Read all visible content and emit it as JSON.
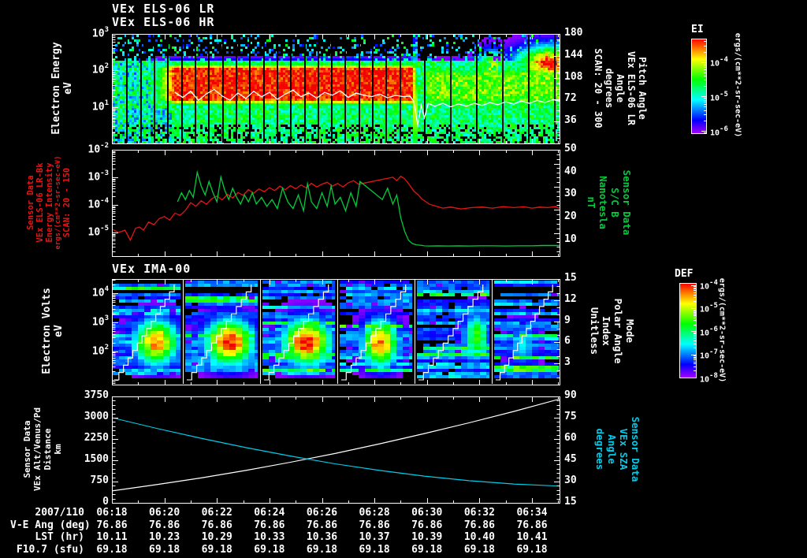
{
  "plot": {
    "date_label": "2007/110",
    "colors": {
      "background": "#000000",
      "frame": "#ffffff",
      "red": "#e81414",
      "green": "#00cd3c",
      "cyan": "#00cdeb",
      "white": "#ffffff"
    }
  },
  "time_axis": {
    "labels": [
      "06:18",
      "06:20",
      "06:22",
      "06:24",
      "06:26",
      "06:28",
      "06:30",
      "06:32",
      "06:34"
    ],
    "start_min": 0,
    "end_min": 17.05,
    "tick_interval_min": 2
  },
  "bottom_table": {
    "rows": [
      {
        "label": "2007/110",
        "values": [
          "06:18",
          "06:20",
          "06:22",
          "06:24",
          "06:26",
          "06:28",
          "06:30",
          "06:32",
          "06:34"
        ]
      },
      {
        "label": "V-E Ang (deg)",
        "values": [
          "76.86",
          "76.86",
          "76.86",
          "76.86",
          "76.86",
          "76.86",
          "76.86",
          "76.86",
          "76.86"
        ]
      },
      {
        "label": "LST (hr)",
        "values": [
          "10.11",
          "10.23",
          "10.29",
          "10.33",
          "10.36",
          "10.37",
          "10.39",
          "10.40",
          "10.41"
        ]
      },
      {
        "label": "F10.7 (sfu)",
        "values": [
          "69.18",
          "69.18",
          "69.18",
          "69.18",
          "69.18",
          "69.18",
          "69.18",
          "69.18",
          "69.18"
        ]
      }
    ]
  },
  "chart_data": [
    {
      "id": "els-spectrogram",
      "type": "heatmap",
      "titles": [
        "VEx ELS-06 LR",
        "VEx ELS-06 HR"
      ],
      "y_axis": {
        "label_lines": [
          "Electron Energy",
          "eV"
        ],
        "scale": "log",
        "ticks": [
          "10^3",
          "10^2",
          "10^1"
        ],
        "range_log10": [
          0,
          3
        ]
      },
      "right_axis": {
        "label_lines": [
          "Pitch Angle",
          "VEx ELS-06 LR",
          "Angle",
          "degrees",
          "SCAN: 20 - 300"
        ],
        "ticks": [
          180,
          144,
          108,
          72,
          36
        ],
        "range": [
          0,
          180
        ]
      },
      "colorbar": {
        "title": "EI",
        "ticks": [
          "10^-4",
          "10^-5",
          "10^-6"
        ],
        "range_log10": [
          -3.32,
          -6.07
        ],
        "unit": "ergs/(cm**2-sr-sec-eV)"
      },
      "description": "Electron energy-time spectrogram: intense 15-100 eV magnetosheath electron flux from ~06:20 to ~06:29.5, abrupt cutoff near 06:29.5, weaker yellow-green ionospheric flux after; scattered counts above 200 eV; regular vertical telemetry-gap stripes.",
      "overlay_line": {
        "name": "spacecraft-potential-trace",
        "color": "#ffffff",
        "t_min": [
          2.4,
          2.7,
          3.0,
          3.3,
          3.6,
          3.9,
          4.2,
          4.5,
          4.8,
          5.1,
          5.4,
          5.7,
          6.0,
          6.3,
          6.6,
          6.9,
          7.2,
          7.5,
          7.8,
          8.1,
          8.4,
          8.7,
          9.0,
          9.3,
          9.6,
          9.9,
          10.2,
          10.5,
          10.8,
          11.1,
          11.35,
          11.5,
          11.65,
          11.78,
          11.9,
          12.05,
          12.3,
          12.6,
          12.9,
          13.2,
          13.5,
          13.8,
          14.1,
          14.4,
          14.7,
          15.0,
          15.3,
          15.6,
          15.9,
          16.2,
          16.5,
          16.8,
          17.05
        ],
        "log10_eV": [
          1.4,
          1.26,
          1.43,
          1.18,
          1.36,
          1.48,
          1.3,
          1.18,
          1.38,
          1.23,
          1.43,
          1.28,
          1.4,
          1.21,
          1.35,
          1.46,
          1.28,
          1.38,
          1.24,
          1.4,
          1.32,
          1.44,
          1.26,
          1.38,
          1.32,
          1.28,
          1.35,
          1.25,
          1.32,
          1.28,
          1.3,
          1.15,
          0.5,
          1.05,
          0.7,
          1.1,
          1.02,
          1.1,
          1.0,
          1.08,
          1.02,
          1.1,
          1.04,
          1.12,
          1.06,
          1.14,
          1.08,
          1.16,
          1.1,
          1.18,
          1.12,
          1.2,
          1.16
        ]
      },
      "render": {
        "seed": 42,
        "band_center_log10": 1.62,
        "band_halfwidth": 0.38,
        "band_fringe_sigma": 0.15,
        "band_t_start": 1.1,
        "band_t_full": 2.4,
        "band_t_end": 11.45,
        "post_center_log10": 1.55,
        "post_halfwidth": 0.3,
        "post_amp": 0.64,
        "gap_t0": 0.55,
        "gap_t1": 11.4,
        "gap_step_min": 0.52,
        "gap2_t0": 11.9,
        "gap2_step_min": 0.99
      }
    },
    {
      "id": "els-intensity-and-bfield",
      "type": "line",
      "left_axis": {
        "color_key": "red",
        "label_lines": [
          "Sensor Data",
          "VEx ELS-06 LR-Bk",
          "Energy Intensity",
          "ergs/(cm**2-sr-sec-eV)",
          "SCAN: 20 - 150"
        ],
        "scale": "log",
        "ticks": [
          "10^-2",
          "10^-3",
          "10^-4",
          "10^-5"
        ],
        "range_log10": [
          -5.86,
          -2
        ]
      },
      "right_axis": {
        "color_key": "green",
        "label_lines": [
          "Sensor Data",
          "S/C B",
          "Nanotesla",
          "nT"
        ],
        "ticks": [
          50,
          40,
          30,
          20,
          10
        ],
        "range": [
          3,
          50
        ]
      },
      "series": [
        {
          "name": "ELS-06 LR-Bk energy intensity",
          "axis": "left",
          "color": "#e81414",
          "t_min": [
            0.0,
            0.25,
            0.5,
            0.7,
            0.9,
            1.05,
            1.2,
            1.4,
            1.6,
            1.8,
            2.0,
            2.2,
            2.4,
            2.6,
            2.8,
            3.0,
            3.2,
            3.4,
            3.6,
            3.8,
            4.0,
            4.2,
            4.4,
            4.6,
            4.8,
            5.0,
            5.2,
            5.4,
            5.6,
            5.8,
            6.0,
            6.2,
            6.4,
            6.6,
            6.8,
            7.0,
            7.2,
            7.4,
            7.6,
            7.8,
            8.0,
            8.2,
            8.4,
            8.6,
            8.8,
            9.0,
            9.2,
            9.4,
            10.7,
            10.85,
            11.0,
            11.15,
            11.35,
            11.5,
            11.65,
            11.8,
            11.95,
            12.1,
            12.35,
            12.6,
            12.9,
            13.3,
            13.7,
            14.1,
            14.5,
            14.9,
            15.3,
            15.7,
            16.0,
            16.3,
            16.6,
            16.9,
            17.0,
            17.05
          ],
          "log10_v": [
            -4.88,
            -5.0,
            -4.92,
            -5.28,
            -4.85,
            -4.8,
            -4.92,
            -4.62,
            -4.72,
            -4.5,
            -4.42,
            -4.55,
            -4.3,
            -4.38,
            -4.2,
            -3.92,
            -4.05,
            -3.85,
            -3.98,
            -3.78,
            -3.68,
            -3.82,
            -3.62,
            -3.75,
            -3.55,
            -3.65,
            -3.45,
            -3.58,
            -3.42,
            -3.52,
            -3.38,
            -3.48,
            -3.32,
            -3.45,
            -3.3,
            -3.42,
            -3.28,
            -3.38,
            -3.22,
            -3.35,
            -3.25,
            -3.18,
            -3.32,
            -3.22,
            -3.35,
            -3.2,
            -3.12,
            -3.25,
            -3.0,
            -3.12,
            -2.96,
            -3.05,
            -3.3,
            -3.5,
            -3.62,
            -3.78,
            -3.88,
            -3.98,
            -4.05,
            -4.12,
            -4.08,
            -4.15,
            -4.1,
            -4.08,
            -4.12,
            -4.06,
            -4.1,
            -4.07,
            -4.12,
            -4.08,
            -4.1,
            -4.06,
            -4.12,
            -4.09
          ]
        },
        {
          "name": "spacecraft magnetic field B",
          "axis": "right",
          "color": "#00cd3c",
          "t_min": [
            2.5,
            2.65,
            2.8,
            2.95,
            3.1,
            3.25,
            3.4,
            3.55,
            3.7,
            3.85,
            4.0,
            4.15,
            4.3,
            4.45,
            4.6,
            4.75,
            4.9,
            5.05,
            5.2,
            5.35,
            5.5,
            5.7,
            5.9,
            6.1,
            6.3,
            6.5,
            6.7,
            6.9,
            7.1,
            7.3,
            7.45,
            7.6,
            7.8,
            8.0,
            8.2,
            8.35,
            8.5,
            8.7,
            8.9,
            9.1,
            9.3,
            9.45,
            10.3,
            10.5,
            10.7,
            10.85,
            11.0,
            11.15,
            11.3,
            11.45,
            11.6,
            11.75,
            11.9,
            12.1,
            12.4,
            12.8,
            13.2,
            13.6,
            14.0,
            14.5,
            15.0,
            15.5,
            16.0,
            16.4,
            16.8,
            17.05
          ],
          "nT": [
            27,
            31,
            28,
            32,
            29,
            40,
            34,
            30,
            36,
            31,
            27,
            38,
            32,
            28,
            33,
            29,
            26,
            30,
            27,
            31,
            26,
            29,
            25,
            28,
            24,
            33,
            27,
            24,
            30,
            23,
            35,
            27,
            24,
            31,
            25,
            34,
            26,
            29,
            23,
            31,
            25,
            36,
            28,
            33,
            26,
            30,
            20,
            14,
            10,
            8.5,
            8,
            7.8,
            7.6,
            7.5,
            7.6,
            7.5,
            7.6,
            7.5,
            7.6,
            7.6,
            7.5,
            7.6,
            7.6,
            7.7,
            7.7,
            7.7
          ]
        }
      ]
    },
    {
      "id": "ima-spectrogram",
      "type": "heatmap",
      "title": "VEx IMA-00",
      "y_axis": {
        "label_lines": [
          "Electron Volts",
          "eV"
        ],
        "scale": "log",
        "ticks": [
          "10^4",
          "10^3",
          "10^2"
        ],
        "range_log10": [
          0.85,
          4.5
        ]
      },
      "right_axis": {
        "label_lines": [
          "Mode",
          "Polar Angle",
          "Index",
          "Unitless"
        ],
        "ticks": [
          15,
          12,
          9,
          6,
          3
        ],
        "range": [
          0,
          15
        ]
      },
      "colorbar": {
        "title": "DEF",
        "ticks": [
          "10^-4",
          "10^-5",
          "10^-6",
          "10^-7",
          "10^-8"
        ],
        "range_log10": [
          -3.9,
          -8.0
        ],
        "unit": "ergs/(cm**2-sr-sec-eV)"
      },
      "description": "Ion mass analyzer energy-time spectrogram in six sweep segments separated by white lines; 100-500 eV ion beam blobs in each segment (weakening after ~06:29); white stepped energy-sweep staircase in every segment; noisy blue horizontal count stripes.",
      "render": {
        "seed": 7,
        "segment_bounds_min": [
          0,
          2.7,
          5.64,
          8.59,
          11.53,
          14.47,
          17.05
        ],
        "blobs": [
          {
            "amp": 0.9,
            "cE": 2.3,
            "pos": 0.62,
            "w": 0.22
          },
          {
            "amp": 1.0,
            "cE": 2.3,
            "pos": 0.6,
            "w": 0.22
          },
          {
            "amp": 1.0,
            "cE": 2.3,
            "pos": 0.6,
            "w": 0.22
          },
          {
            "amp": 0.95,
            "cE": 2.25,
            "pos": 0.55,
            "w": 0.16
          },
          {
            "amp": 0.62,
            "cE": 2.5,
            "pos": 0.8,
            "w": 0.12
          },
          {
            "amp": 0.35,
            "cE": 2.2,
            "pos": 0.45,
            "w": 0.15
          }
        ]
      }
    },
    {
      "id": "altitude-and-sza",
      "type": "line",
      "left_axis": {
        "color_key": "white",
        "label_lines": [
          "Sensor Data",
          "VEx Alt/Venus/Pd",
          "Distance",
          "km"
        ],
        "ticks": [
          3750,
          3000,
          2250,
          1500,
          750,
          0
        ],
        "range": [
          0,
          3750
        ]
      },
      "right_axis": {
        "color_key": "cyan",
        "label_lines": [
          "Sensor Data",
          "VEx SZA",
          "Angle",
          "degrees"
        ],
        "ticks": [
          90,
          75,
          60,
          45,
          30,
          15
        ],
        "range": [
          15,
          90
        ]
      },
      "series": [
        {
          "name": "VEx altitude above Venus",
          "axis": "left",
          "color": "#ffffff",
          "t_min": [
            0,
            1.7,
            3.4,
            5.1,
            6.8,
            8.5,
            10.2,
            11.9,
            13.6,
            15.3,
            17.05
          ],
          "km": [
            420,
            640,
            880,
            1140,
            1430,
            1740,
            2080,
            2440,
            2820,
            3220,
            3660
          ]
        },
        {
          "name": "VEx solar zenith angle",
          "axis": "right",
          "color": "#00cdeb",
          "t_min": [
            0,
            1.7,
            3.4,
            5.1,
            6.8,
            8.5,
            10.2,
            11.9,
            13.6,
            15.3,
            17.05
          ],
          "deg": [
            75,
            67.5,
            60.5,
            54,
            48,
            42.5,
            37.8,
            33.8,
            30.6,
            28.3,
            26.8
          ]
        }
      ]
    }
  ]
}
